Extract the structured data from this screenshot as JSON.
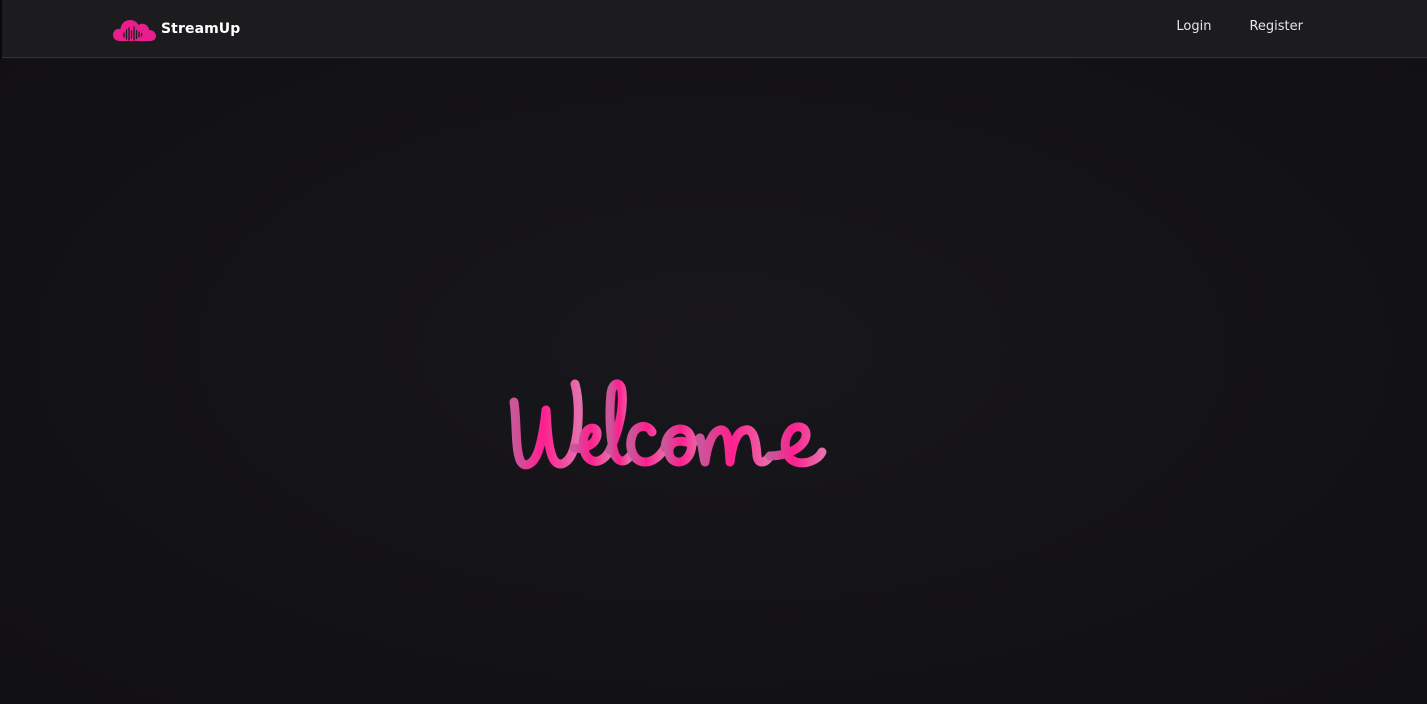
{
  "brand": {
    "name": "StreamUp",
    "logo_icon": "cloud-soundwave-icon",
    "accent_color": "#e91e8c"
  },
  "nav": {
    "login_label": "Login",
    "register_label": "Register"
  },
  "hero": {
    "welcome_text": "Welcome",
    "gradient_colors": [
      "#d4589a",
      "#ff1f8f",
      "#e87bb6"
    ]
  },
  "colors": {
    "background": "#141317",
    "navbar": "#1c1c1e"
  }
}
